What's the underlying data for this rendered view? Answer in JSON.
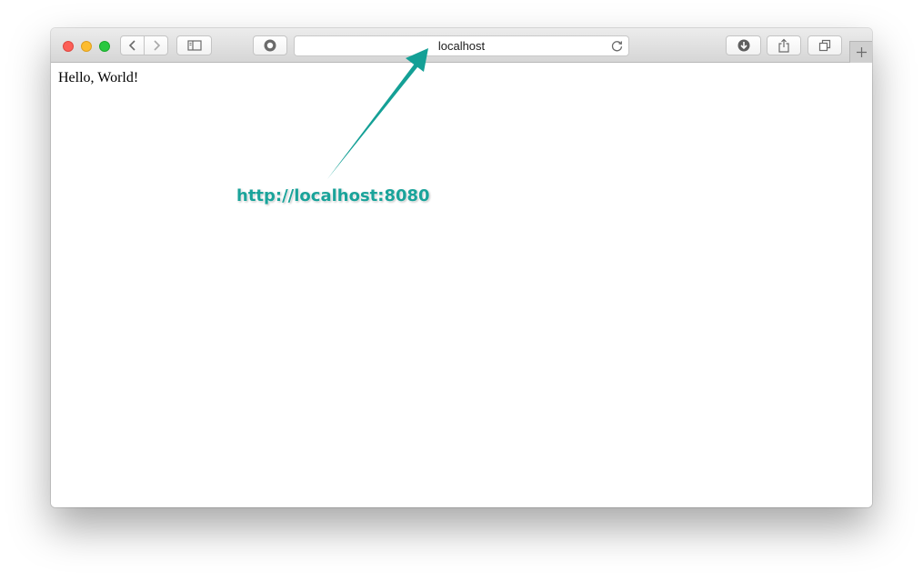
{
  "browser": {
    "address_text": "localhost",
    "new_tab_label": "+",
    "icons": {
      "back": "chevron-left-icon",
      "forward": "chevron-right-icon",
      "sidebar": "sidebar-icon",
      "extension": "circle-icon",
      "reload": "reload-icon",
      "downloads": "download-icon",
      "share": "share-icon",
      "tabs": "tabs-overview-icon"
    }
  },
  "page": {
    "body_text": "Hello, World!"
  },
  "annotation": {
    "label": "http://localhost:8080",
    "color": "#1aa39a"
  }
}
